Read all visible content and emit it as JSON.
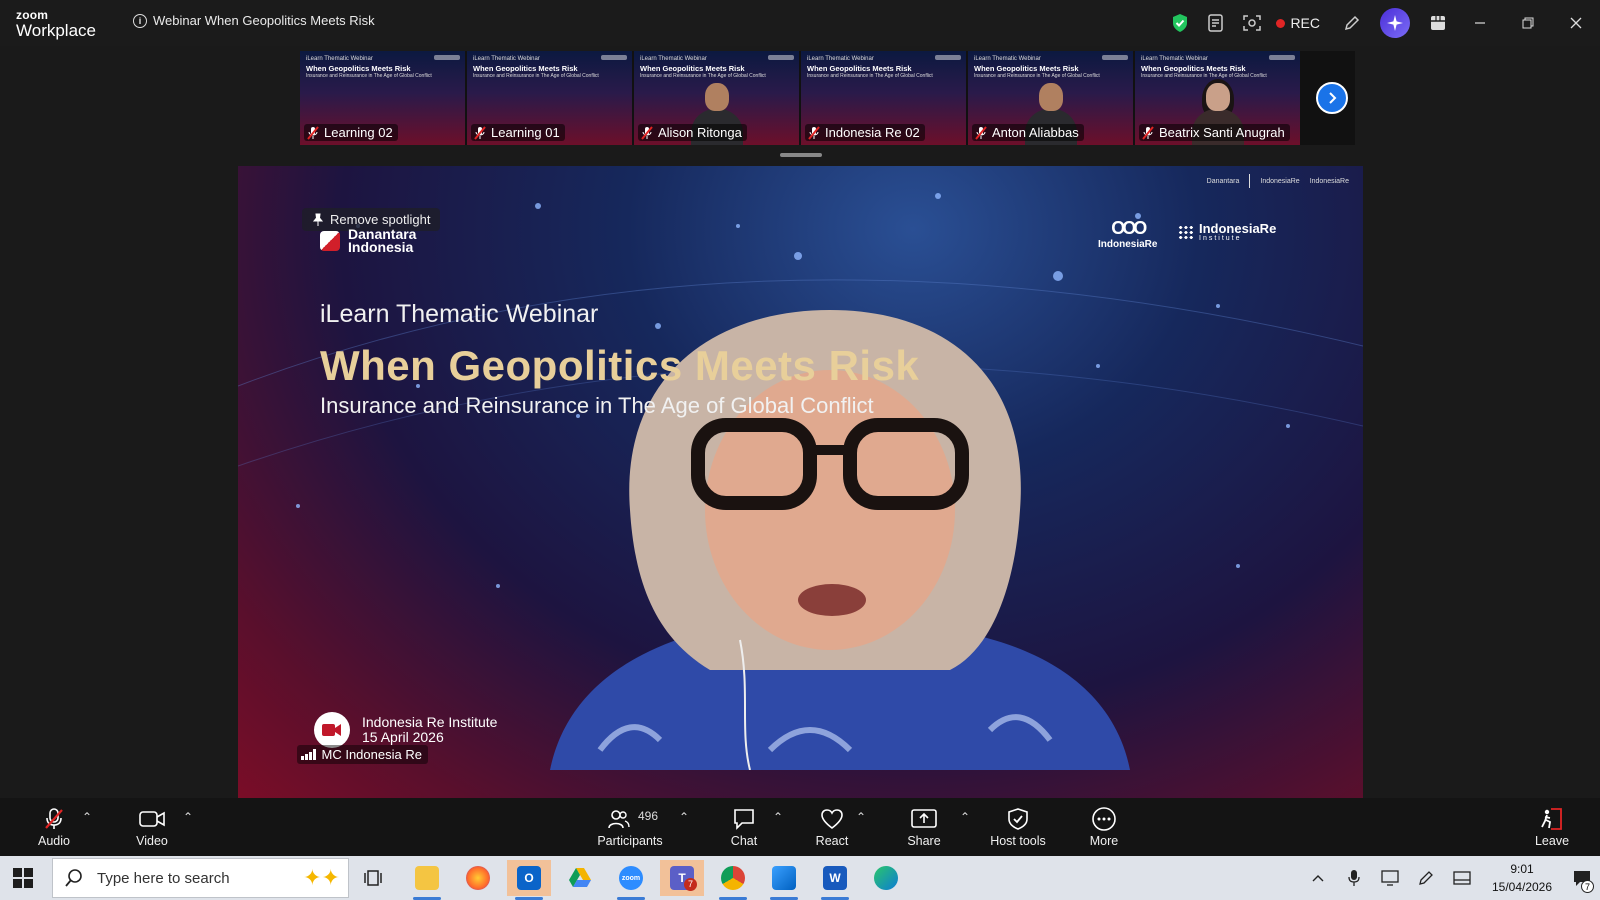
{
  "window": {
    "brand_line1": "zoom",
    "brand_line2": "Workplace",
    "meeting_title": "Webinar When Geopolitics Meets Risk",
    "rec_label": "REC"
  },
  "participants_strip": {
    "thumbnails": [
      {
        "name": "Learning 02",
        "video": false,
        "muted": true
      },
      {
        "name": "Learning 01",
        "video": false,
        "muted": true
      },
      {
        "name": "Alison Ritonga",
        "video": true,
        "muted": true
      },
      {
        "name": "Indonesia Re 02",
        "video": false,
        "muted": true
      },
      {
        "name": "Anton Aliabbas",
        "video": true,
        "muted": true
      },
      {
        "name": "Beatrix Santi Anugrah",
        "video": true,
        "muted": true
      }
    ],
    "mini_slide_kicker": "iLearn Thematic Webinar",
    "mini_slide_title": "When Geopolitics Meets Risk",
    "mini_slide_sub": "Insurance and Reinsurance in The Age of Global Conflict"
  },
  "spotlight": {
    "remove_spotlight_label": "Remove spotlight",
    "danantara_line1": "Danantara",
    "danantara_line2": "Indonesia",
    "indonesia_re_logo": "IndonesiaRe",
    "institute_logo_line1": "IndonesiaRe",
    "institute_logo_line2": "Institute",
    "slide_kicker": "iLearn Thematic Webinar",
    "slide_title": "When Geopolitics Meets Risk",
    "slide_subtitle": "Insurance and Reinsurance in The Age of Global Conflict",
    "footer_org": "Indonesia Re Institute",
    "footer_date": "15 April 2026",
    "speaker_name": "MC Indonesia Re"
  },
  "toolbar": {
    "audio_label": "Audio",
    "video_label": "Video",
    "participants_label": "Participants",
    "participants_count": "496",
    "chat_label": "Chat",
    "react_label": "React",
    "share_label": "Share",
    "host_tools_label": "Host tools",
    "more_label": "More",
    "leave_label": "Leave"
  },
  "taskbar": {
    "search_placeholder": "Type here to search",
    "time": "9:01",
    "date": "15/04/2026",
    "notification_count": "7",
    "teams_badge": "7"
  },
  "colors": {
    "accent_blue": "#1a73e8",
    "rec_red": "#e02525",
    "slide_title_gold": "#e8cf9a",
    "security_green": "#22c55e"
  }
}
